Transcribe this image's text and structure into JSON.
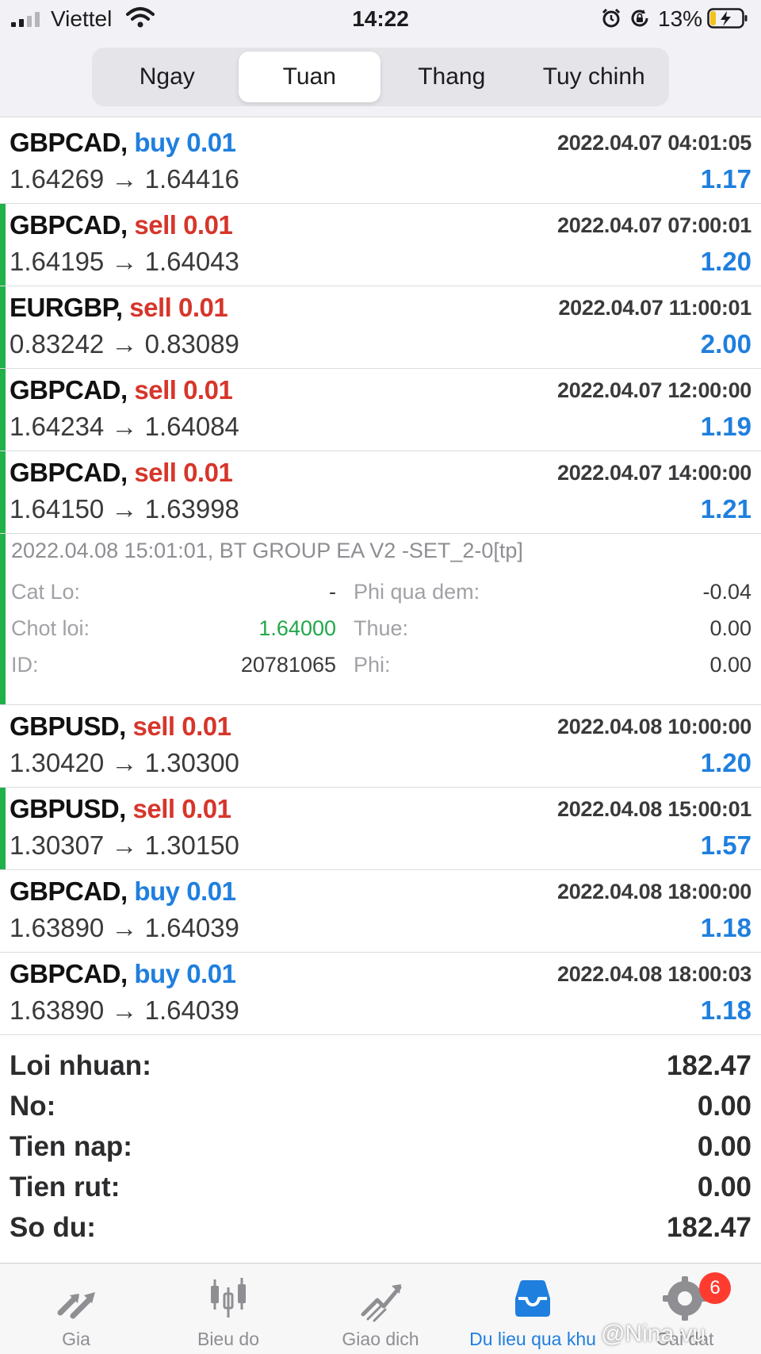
{
  "status_bar": {
    "carrier": "Viettel",
    "time": "14:22",
    "battery_percent": "13%",
    "icons": [
      "signal-icon",
      "wifi-icon",
      "alarm-icon",
      "orientation-lock-icon",
      "battery-charging-icon"
    ]
  },
  "tabs": {
    "items": [
      {
        "label": "Ngay"
      },
      {
        "label": "Tuan"
      },
      {
        "label": "Thang"
      },
      {
        "label": "Tuy chinh"
      }
    ],
    "active_index": 1
  },
  "colors": {
    "buy": "#1f7fde",
    "sell": "#d6362b",
    "profit": "#1f7fde",
    "open_marker": "#21b14b",
    "take_profit": "#21a84a"
  },
  "trades": [
    {
      "symbol": "GBPCAD,",
      "side": "buy 0.01",
      "time": "2022.04.07 04:01:05",
      "prices": "1.64269 → 1.64416",
      "profit": "1.17"
    },
    {
      "symbol": "GBPCAD,",
      "side": "sell 0.01",
      "time": "2022.04.07 07:00:01",
      "prices": "1.64195 → 1.64043",
      "profit": "1.20"
    },
    {
      "symbol": "EURGBP,",
      "side": "sell 0.01",
      "time": "2022.04.07 11:00:01",
      "prices": "0.83242 → 0.83089",
      "profit": "2.00"
    },
    {
      "symbol": "GBPCAD,",
      "side": "sell 0.01",
      "time": "2022.04.07 12:00:00",
      "prices": "1.64234 → 1.64084",
      "profit": "1.19"
    },
    {
      "symbol": "GBPCAD,",
      "side": "sell 0.01",
      "time": "2022.04.07 14:00:00",
      "prices": "1.64150 → 1.63998",
      "profit": "1.21"
    },
    {
      "symbol": "GBPUSD,",
      "side": "sell 0.01",
      "time": "2022.04.08 10:00:00",
      "prices": "1.30420 → 1.30300",
      "profit": "1.20"
    },
    {
      "symbol": "GBPUSD,",
      "side": "sell 0.01",
      "time": "2022.04.08 15:00:01",
      "prices": "1.30307 → 1.30150",
      "profit": "1.57"
    },
    {
      "symbol": "GBPCAD,",
      "side": "buy 0.01",
      "time": "2022.04.08 18:00:00",
      "prices": "1.63890 → 1.64039",
      "profit": "1.18"
    },
    {
      "symbol": "GBPCAD,",
      "side": "buy 0.01",
      "time": "2022.04.08 18:00:03",
      "prices": "1.63890 → 1.64039",
      "profit": "1.18"
    }
  ],
  "details": {
    "comment": "2022.04.08 15:01:01, BT GROUP EA V2 -SET_2-0[tp]",
    "stop_loss_label": "Cat Lo:",
    "stop_loss_value": "-",
    "take_profit_label": "Chot loi:",
    "take_profit_value": "1.64000",
    "id_label": "ID:",
    "id_value": "20781065",
    "swap_label": "Phi qua dem:",
    "swap_value": "-0.04",
    "tax_label": "Thue:",
    "tax_value": "0.00",
    "fee_label": "Phi:",
    "fee_value": "0.00"
  },
  "summary": [
    {
      "label": "Loi nhuan:",
      "value": "182.47"
    },
    {
      "label": "No:",
      "value": "0.00"
    },
    {
      "label": "Tien nap:",
      "value": "0.00"
    },
    {
      "label": "Tien rut:",
      "value": "0.00"
    },
    {
      "label": "So du:",
      "value": "182.47"
    }
  ],
  "tabbar": {
    "items": [
      {
        "label": "Gia",
        "icon": "quotes-arrows-icon"
      },
      {
        "label": "Bieu do",
        "icon": "candlestick-chart-icon"
      },
      {
        "label": "Giao dich",
        "icon": "trade-chart-icon"
      },
      {
        "label": "Du lieu qua khu",
        "icon": "history-inbox-icon"
      },
      {
        "label": "Cai dat",
        "icon": "settings-gear-icon"
      }
    ],
    "active_index": 3,
    "badge": "6"
  },
  "watermark": "@Nina vu"
}
